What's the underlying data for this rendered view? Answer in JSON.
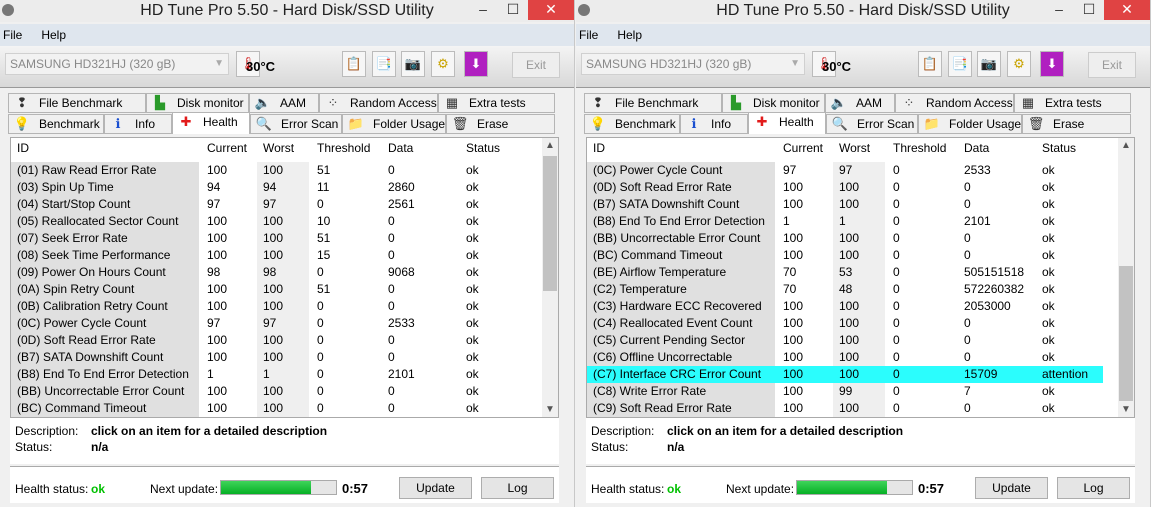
{
  "colors": {
    "ok": "#00c000",
    "highlight": "#2bfdfd",
    "progress": "#06b025"
  },
  "windows": [
    {
      "title": "HD Tune Pro 5.50 - Hard Disk/SSD Utility",
      "menu": [
        "File",
        "Help"
      ],
      "drive": "SAMSUNG HD321HJ (320 gB)",
      "temperature": "30°C",
      "exit_label": "Exit",
      "tabs_row1": [
        {
          "label": "File Benchmark",
          "icon": "file-benchmark-icon"
        },
        {
          "label": "Disk monitor",
          "icon": "disk-monitor-icon"
        },
        {
          "label": "AAM",
          "icon": "speaker-icon"
        },
        {
          "label": "Random Access",
          "icon": "random-access-icon"
        },
        {
          "label": "Extra tests",
          "icon": "extra-tests-icon"
        }
      ],
      "tabs_row2": [
        {
          "label": "Benchmark",
          "icon": "lightbulb-icon"
        },
        {
          "label": "Info",
          "icon": "info-icon"
        },
        {
          "label": "Health",
          "icon": "red-cross-icon",
          "active": true
        },
        {
          "label": "Error Scan",
          "icon": "magnifier-icon"
        },
        {
          "label": "Folder Usage",
          "icon": "folder-icon"
        },
        {
          "label": "Erase",
          "icon": "trash-icon"
        }
      ],
      "columns": [
        "ID",
        "Current",
        "Worst",
        "Threshold",
        "Data",
        "Status"
      ],
      "scroll": {
        "position": 0.0,
        "visible_fraction": 0.55
      },
      "rows": [
        [
          "(01) Raw Read Error Rate",
          "100",
          "100",
          "51",
          "0",
          "ok"
        ],
        [
          "(03) Spin Up Time",
          "94",
          "94",
          "11",
          "2860",
          "ok"
        ],
        [
          "(04) Start/Stop Count",
          "97",
          "97",
          "0",
          "2561",
          "ok"
        ],
        [
          "(05) Reallocated Sector Count",
          "100",
          "100",
          "10",
          "0",
          "ok"
        ],
        [
          "(07) Seek Error Rate",
          "100",
          "100",
          "51",
          "0",
          "ok"
        ],
        [
          "(08) Seek Time Performance",
          "100",
          "100",
          "15",
          "0",
          "ok"
        ],
        [
          "(09) Power On Hours Count",
          "98",
          "98",
          "0",
          "9068",
          "ok"
        ],
        [
          "(0A) Spin Retry Count",
          "100",
          "100",
          "51",
          "0",
          "ok"
        ],
        [
          "(0B) Calibration Retry Count",
          "100",
          "100",
          "0",
          "0",
          "ok"
        ],
        [
          "(0C) Power Cycle Count",
          "97",
          "97",
          "0",
          "2533",
          "ok"
        ],
        [
          "(0D) Soft Read Error Rate",
          "100",
          "100",
          "0",
          "0",
          "ok"
        ],
        [
          "(B7) SATA Downshift Count",
          "100",
          "100",
          "0",
          "0",
          "ok"
        ],
        [
          "(B8) End To End Error Detection",
          "1",
          "1",
          "0",
          "2101",
          "ok"
        ],
        [
          "(BB) Uncorrectable Error Count",
          "100",
          "100",
          "0",
          "0",
          "ok"
        ],
        [
          "(BC) Command Timeout",
          "100",
          "100",
          "0",
          "0",
          "ok"
        ]
      ],
      "highlight_row": -1,
      "description_label": "Description:",
      "description": "click on an item for a detailed description",
      "status_label": "Status:",
      "status": "n/a",
      "health_label": "Health status:",
      "health": "ok",
      "next_update_label": "Next update:",
      "next_update_progress": 0.78,
      "next_update_time": "0:57",
      "update_label": "Update",
      "log_label": "Log"
    },
    {
      "title": "HD Tune Pro 5.50 - Hard Disk/SSD Utility",
      "menu": [
        "File",
        "Help"
      ],
      "drive": "SAMSUNG HD321HJ (320 gB)",
      "temperature": "30°C",
      "exit_label": "Exit",
      "tabs_row1": [
        {
          "label": "File Benchmark",
          "icon": "file-benchmark-icon"
        },
        {
          "label": "Disk monitor",
          "icon": "disk-monitor-icon"
        },
        {
          "label": "AAM",
          "icon": "speaker-icon"
        },
        {
          "label": "Random Access",
          "icon": "random-access-icon"
        },
        {
          "label": "Extra tests",
          "icon": "extra-tests-icon"
        }
      ],
      "tabs_row2": [
        {
          "label": "Benchmark",
          "icon": "lightbulb-icon"
        },
        {
          "label": "Info",
          "icon": "info-icon"
        },
        {
          "label": "Health",
          "icon": "red-cross-icon",
          "active": true
        },
        {
          "label": "Error Scan",
          "icon": "magnifier-icon"
        },
        {
          "label": "Folder Usage",
          "icon": "folder-icon"
        },
        {
          "label": "Erase",
          "icon": "trash-icon"
        }
      ],
      "columns": [
        "ID",
        "Current",
        "Worst",
        "Threshold",
        "Data",
        "Status"
      ],
      "scroll": {
        "position": 1.0,
        "visible_fraction": 0.55
      },
      "rows": [
        [
          "(0C) Power Cycle Count",
          "97",
          "97",
          "0",
          "2533",
          "ok"
        ],
        [
          "(0D) Soft Read Error Rate",
          "100",
          "100",
          "0",
          "0",
          "ok"
        ],
        [
          "(B7) SATA Downshift Count",
          "100",
          "100",
          "0",
          "0",
          "ok"
        ],
        [
          "(B8) End To End Error Detection",
          "1",
          "1",
          "0",
          "2101",
          "ok"
        ],
        [
          "(BB) Uncorrectable Error Count",
          "100",
          "100",
          "0",
          "0",
          "ok"
        ],
        [
          "(BC) Command Timeout",
          "100",
          "100",
          "0",
          "0",
          "ok"
        ],
        [
          "(BE) Airflow Temperature",
          "70",
          "53",
          "0",
          "505151518",
          "ok"
        ],
        [
          "(C2) Temperature",
          "70",
          "48",
          "0",
          "572260382",
          "ok"
        ],
        [
          "(C3) Hardware ECC Recovered",
          "100",
          "100",
          "0",
          "2053000",
          "ok"
        ],
        [
          "(C4) Reallocated Event Count",
          "100",
          "100",
          "0",
          "0",
          "ok"
        ],
        [
          "(C5) Current Pending Sector",
          "100",
          "100",
          "0",
          "0",
          "ok"
        ],
        [
          "(C6) Offline Uncorrectable",
          "100",
          "100",
          "0",
          "0",
          "ok"
        ],
        [
          "(C7) Interface CRC Error Count",
          "100",
          "100",
          "0",
          "15709",
          "attention"
        ],
        [
          "(C8) Write Error Rate",
          "100",
          "99",
          "0",
          "7",
          "ok"
        ],
        [
          "(C9) Soft Read Error Rate",
          "100",
          "100",
          "0",
          "0",
          "ok"
        ]
      ],
      "highlight_row": 12,
      "description_label": "Description:",
      "description": "click on an item for a detailed description",
      "status_label": "Status:",
      "status": "n/a",
      "health_label": "Health status:",
      "health": "ok",
      "next_update_label": "Next update:",
      "next_update_progress": 0.78,
      "next_update_time": "0:57",
      "update_label": "Update",
      "log_label": "Log"
    }
  ]
}
